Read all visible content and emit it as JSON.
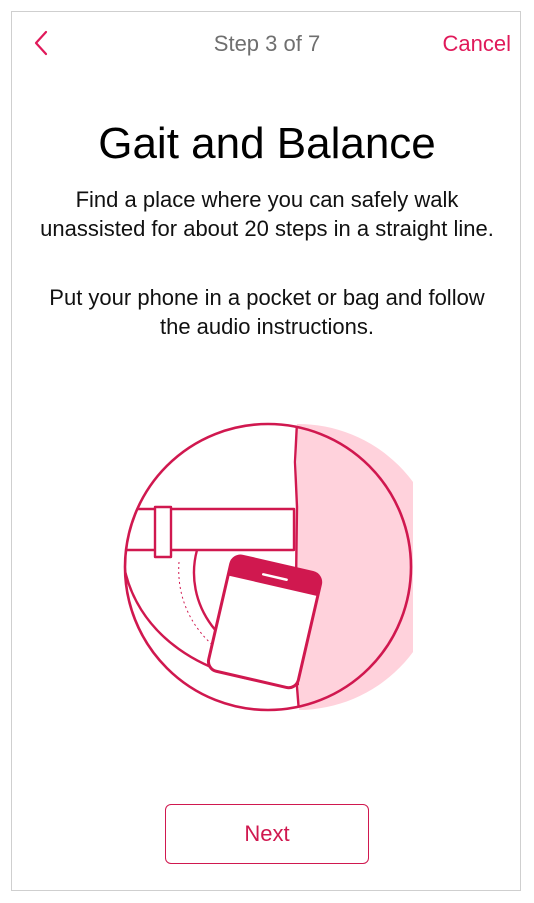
{
  "nav": {
    "step_text": "Step 3 of 7",
    "cancel_label": "Cancel",
    "back_icon": "chevron-left-icon"
  },
  "content": {
    "title": "Gait and Balance",
    "paragraph_1": "Find a place where you can safely walk unassisted for about 20 steps in a straight line.",
    "paragraph_2": "Put your phone in a pocket or bag and follow the audio instructions."
  },
  "illustration": {
    "icon": "phone-in-pocket-illustration"
  },
  "footer": {
    "next_label": "Next"
  },
  "colors": {
    "accent": "#e0195a",
    "illustration_fill": "#ffd2dc",
    "text_secondary": "#6f6f6f"
  }
}
